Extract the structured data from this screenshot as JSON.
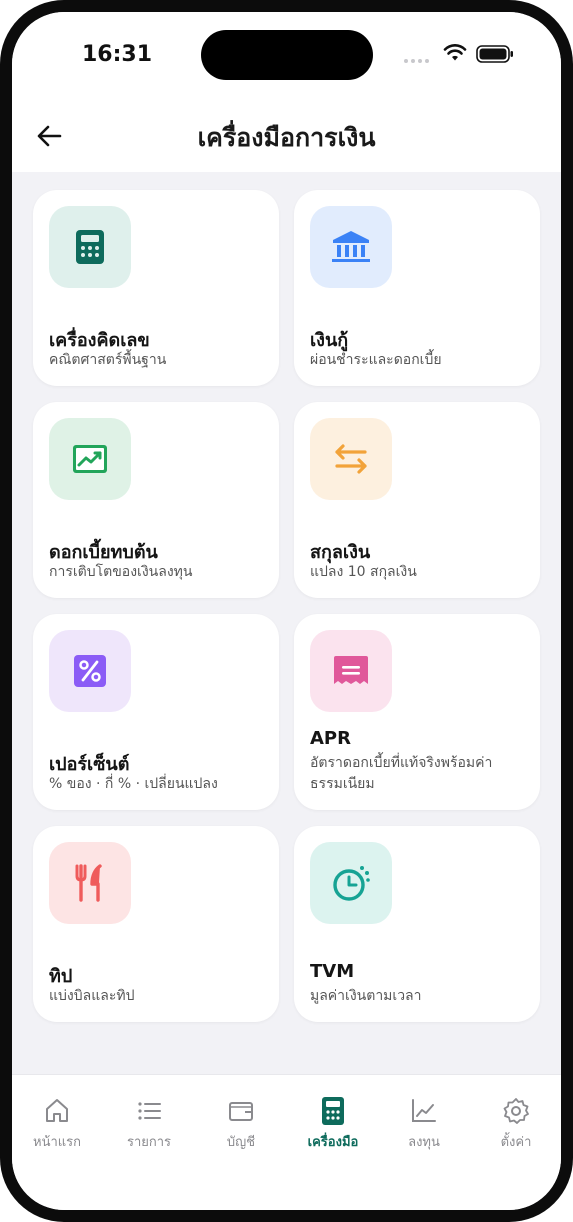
{
  "status_bar": {
    "time": "16:31"
  },
  "header": {
    "title": "เครื่องมือการเงิน"
  },
  "tools": [
    {
      "title": "เครื่องคิดเลข",
      "subtitle": "คณิตศาสตร์พื้นฐาน",
      "icon": "calculator-icon",
      "color": "#0e6b5c",
      "bg": "#dff0ec"
    },
    {
      "title": "เงินกู้",
      "subtitle": "ผ่อนชำระและดอกเบี้ย",
      "icon": "bank-icon",
      "color": "#3b82f6",
      "bg": "#e1ecfd"
    },
    {
      "title": "ดอกเบี้ยทบต้น",
      "subtitle": "การเติบโตของเงินลงทุน",
      "icon": "chart-up-icon",
      "color": "#22a55a",
      "bg": "#dff2e6"
    },
    {
      "title": "สกุลเงิน",
      "subtitle": "แปลง 10 สกุลเงิน",
      "icon": "swap-icon",
      "color": "#f2a33a",
      "bg": "#fdf0df"
    },
    {
      "title": "เปอร์เซ็นต์",
      "subtitle": "% ของ · กี่ % · เปลี่ยนแปลง",
      "icon": "percent-icon",
      "color": "#8b5cf6",
      "bg": "#efe6fb"
    },
    {
      "title": "APR",
      "subtitle": "อัตราดอกเบี้ยที่แท้จริงพร้อมค่าธรรมเนียม",
      "icon": "receipt-icon",
      "color": "#e0589a",
      "bg": "#fbe3ee"
    },
    {
      "title": "ทิป",
      "subtitle": "แบ่งบิลและทิป",
      "icon": "utensils-icon",
      "color": "#ef5b5b",
      "bg": "#fde4e4"
    },
    {
      "title": "TVM",
      "subtitle": "มูลค่าเงินตามเวลา",
      "icon": "clock-icon",
      "color": "#16a394",
      "bg": "#dcf3ef"
    }
  ],
  "tabbar": {
    "items": [
      {
        "label": "หน้าแรก",
        "icon": "home-icon"
      },
      {
        "label": "รายการ",
        "icon": "list-icon"
      },
      {
        "label": "บัญชี",
        "icon": "wallet-icon"
      },
      {
        "label": "เครื่องมือ",
        "icon": "calculator-icon",
        "active": true
      },
      {
        "label": "ลงทุน",
        "icon": "chart-icon"
      },
      {
        "label": "ตั้งค่า",
        "icon": "gear-icon"
      }
    ]
  },
  "colors": {
    "accent": "#0e6b5c",
    "inactive": "#8a8a8e"
  }
}
